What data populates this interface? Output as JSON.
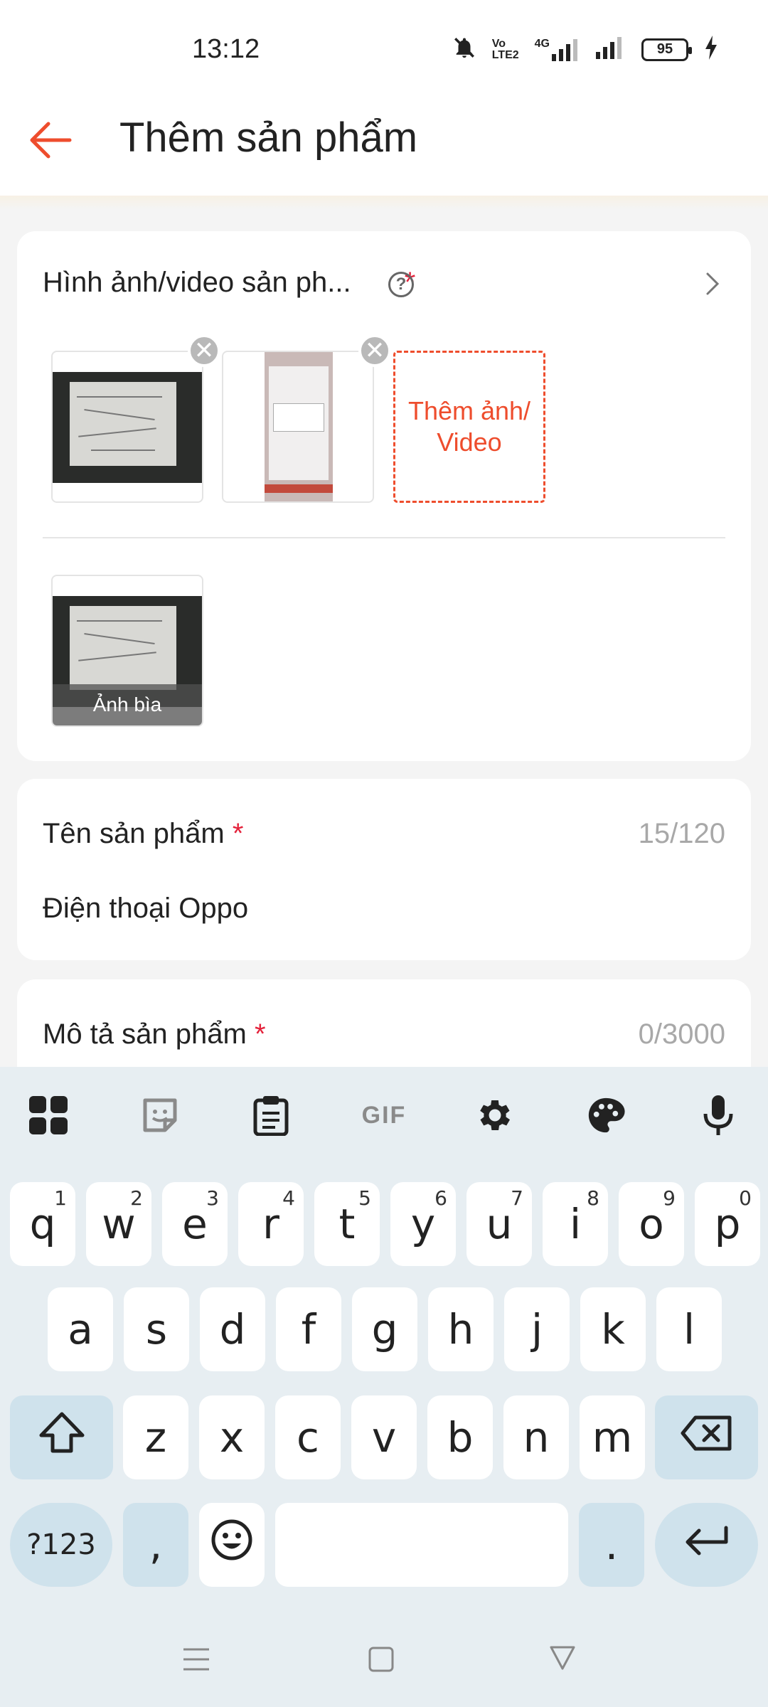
{
  "status_bar": {
    "time": "13:12",
    "volte_line1": "Vo",
    "volte_line2": "LTE2",
    "network": "4G",
    "battery": "95"
  },
  "header": {
    "title": "Thêm sản phẩm"
  },
  "media_section": {
    "title": "Hình ảnh/video sản ph...",
    "required_mark": "*",
    "help": "?",
    "add_button": "Thêm ảnh/ Video",
    "cover_label": "Ảnh bìa"
  },
  "name_section": {
    "label": "Tên sản phẩm",
    "required_mark": "*",
    "counter": "15/120",
    "value": "Điện thoại Oppo"
  },
  "description_section": {
    "label": "Mô tả sản phẩm",
    "required_mark": "*",
    "counter": "0/3000"
  },
  "keyboard": {
    "toolbar_gif": "GIF",
    "row1": [
      {
        "k": "q",
        "n": "1"
      },
      {
        "k": "w",
        "n": "2"
      },
      {
        "k": "e",
        "n": "3"
      },
      {
        "k": "r",
        "n": "4"
      },
      {
        "k": "t",
        "n": "5"
      },
      {
        "k": "y",
        "n": "6"
      },
      {
        "k": "u",
        "n": "7"
      },
      {
        "k": "i",
        "n": "8"
      },
      {
        "k": "o",
        "n": "9"
      },
      {
        "k": "p",
        "n": "0"
      }
    ],
    "row2": [
      "a",
      "s",
      "d",
      "f",
      "g",
      "h",
      "j",
      "k",
      "l"
    ],
    "row3": [
      "z",
      "x",
      "c",
      "v",
      "b",
      "n",
      "m"
    ],
    "symbols_key": "?123",
    "comma_key": ",",
    "period_key": "."
  },
  "colors": {
    "accent": "#ee4d2d",
    "required": "#e4223b",
    "keyboard_bg": "#e7eef2",
    "modifier_key": "#cfe2ec"
  }
}
